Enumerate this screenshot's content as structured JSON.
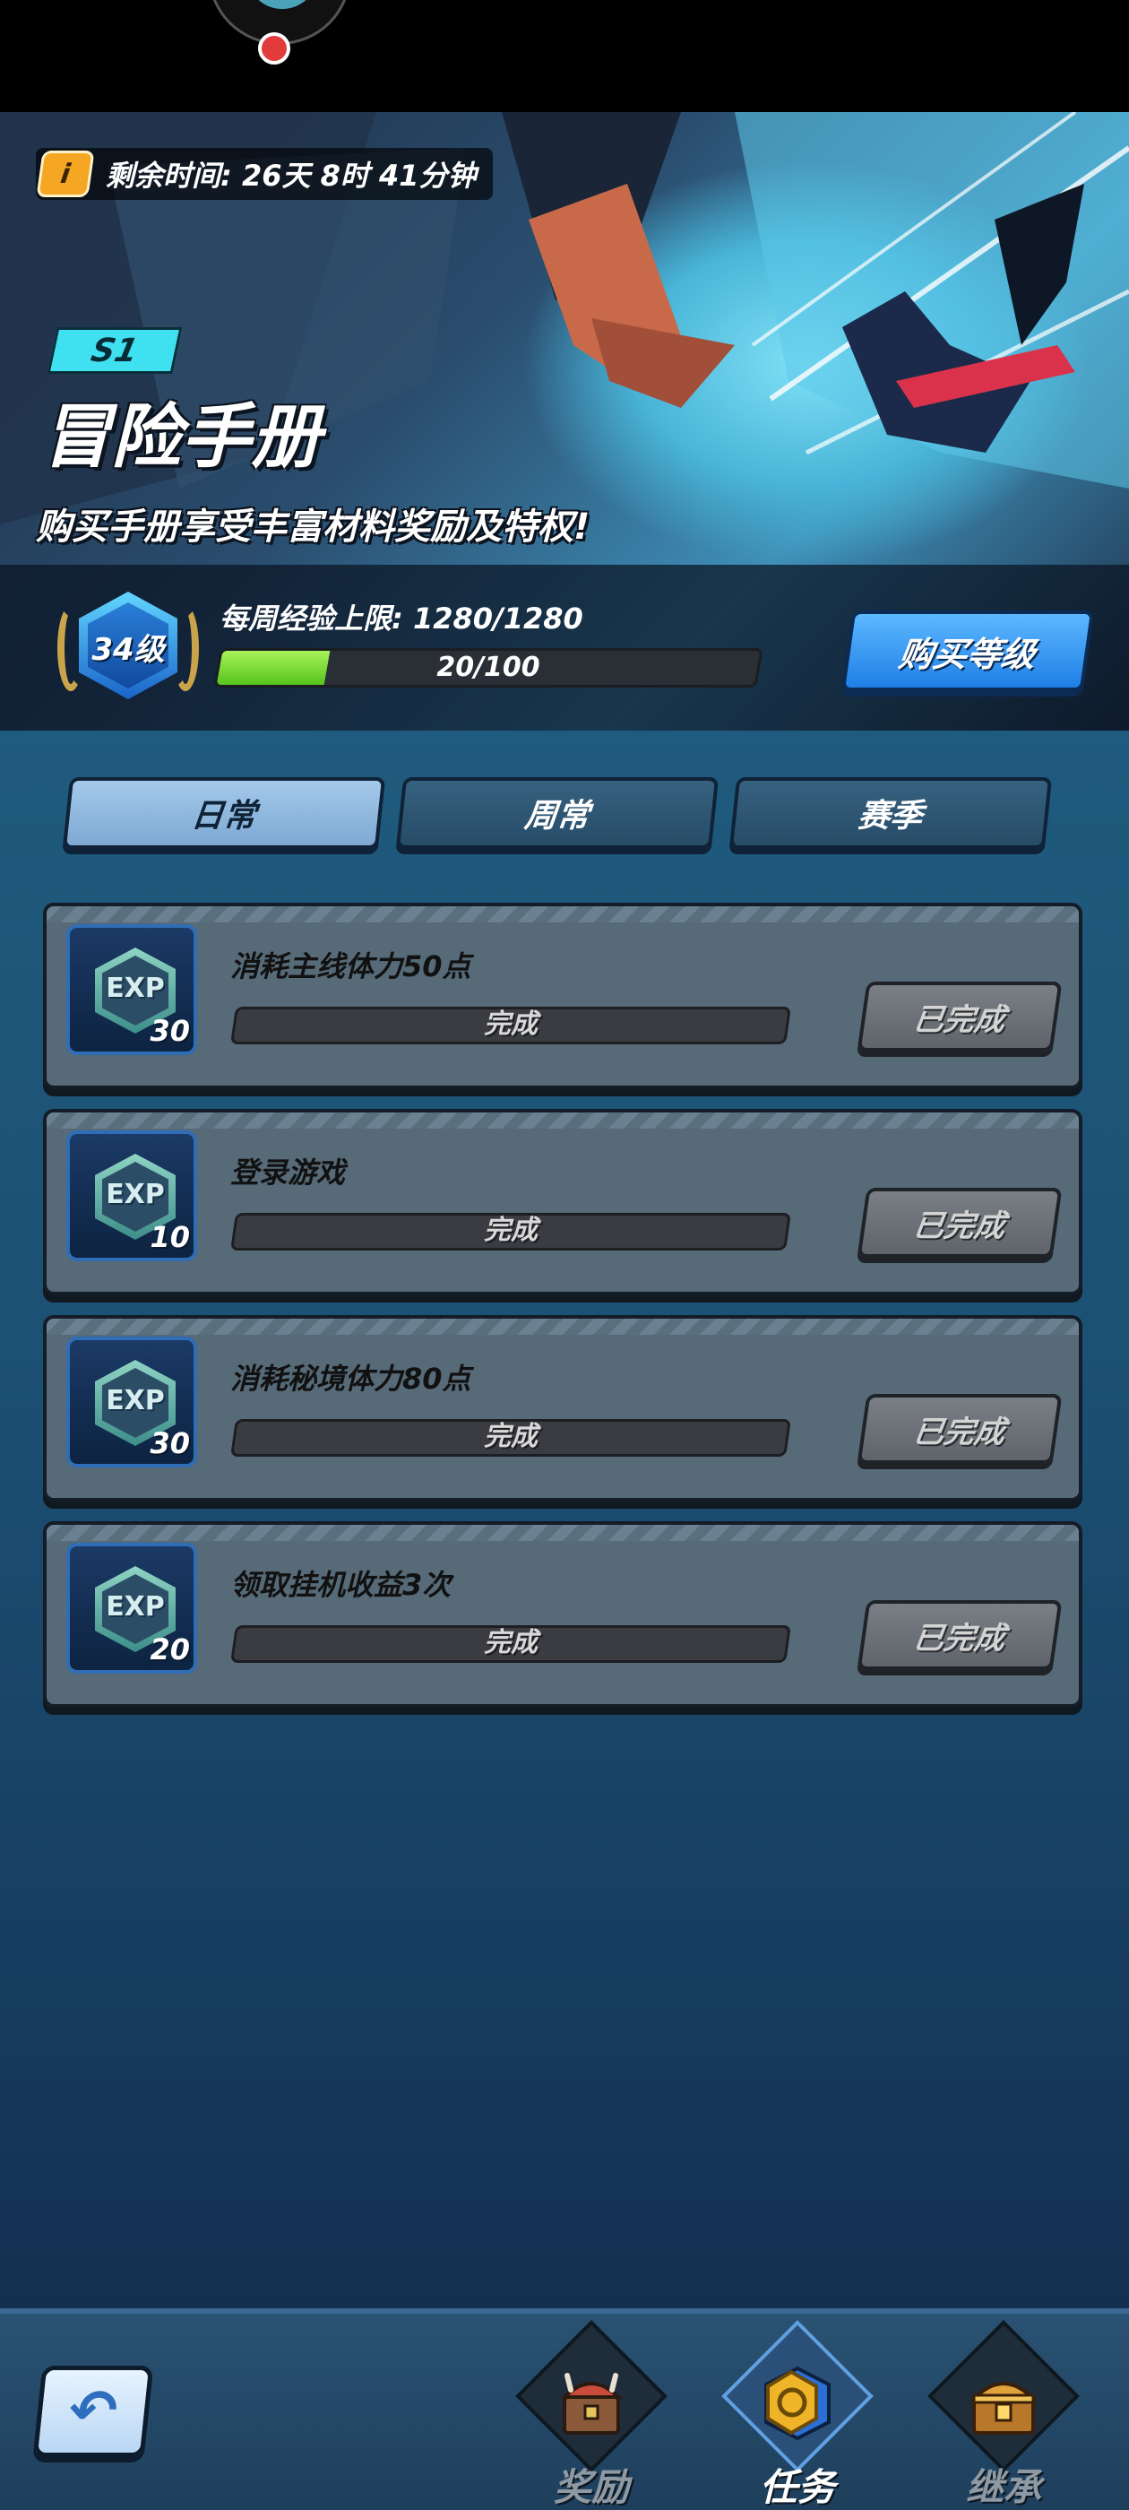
{
  "banner": {
    "timer_icon": "i",
    "timer": "剩余时间: 26天 8时 41分钟",
    "season": "S1",
    "title": "冒险手册",
    "subtitle": "购买手册享受丰富材料奖励及特权!",
    "level": "34级",
    "weekly_limit": "每周经验上限:  1280/1280",
    "exp_text": "20/100",
    "exp_progress": 0.2,
    "buy_button": "购买等级"
  },
  "tabs": [
    {
      "label": "日常",
      "active": true
    },
    {
      "label": "周常",
      "active": false
    },
    {
      "label": "赛季",
      "active": false
    }
  ],
  "tasks": [
    {
      "exp_label": "EXP",
      "exp": "30",
      "title": "消耗主线体力50点",
      "progress_text": "完成",
      "button": "已完成"
    },
    {
      "exp_label": "EXP",
      "exp": "10",
      "title": "登录游戏",
      "progress_text": "完成",
      "button": "已完成"
    },
    {
      "exp_label": "EXP",
      "exp": "30",
      "title": "消耗秘境体力80点",
      "progress_text": "完成",
      "button": "已完成"
    },
    {
      "exp_label": "EXP",
      "exp": "20",
      "title": "领取挂机收益3次",
      "progress_text": "完成",
      "button": "已完成"
    }
  ],
  "nav": {
    "back_icon": "back-arrow-icon",
    "items": [
      {
        "label": "奖励",
        "icon": "reward-chest-icon",
        "active": false
      },
      {
        "label": "任务",
        "icon": "task-badge-icon",
        "active": true
      },
      {
        "label": "继承",
        "icon": "treasure-chest-icon",
        "active": false
      }
    ]
  },
  "colors": {
    "accent": "#1f7fe6",
    "exp_fill": "#56c41e",
    "season_tag": "#3fe0f0",
    "timer_icon": "#f5a623"
  }
}
